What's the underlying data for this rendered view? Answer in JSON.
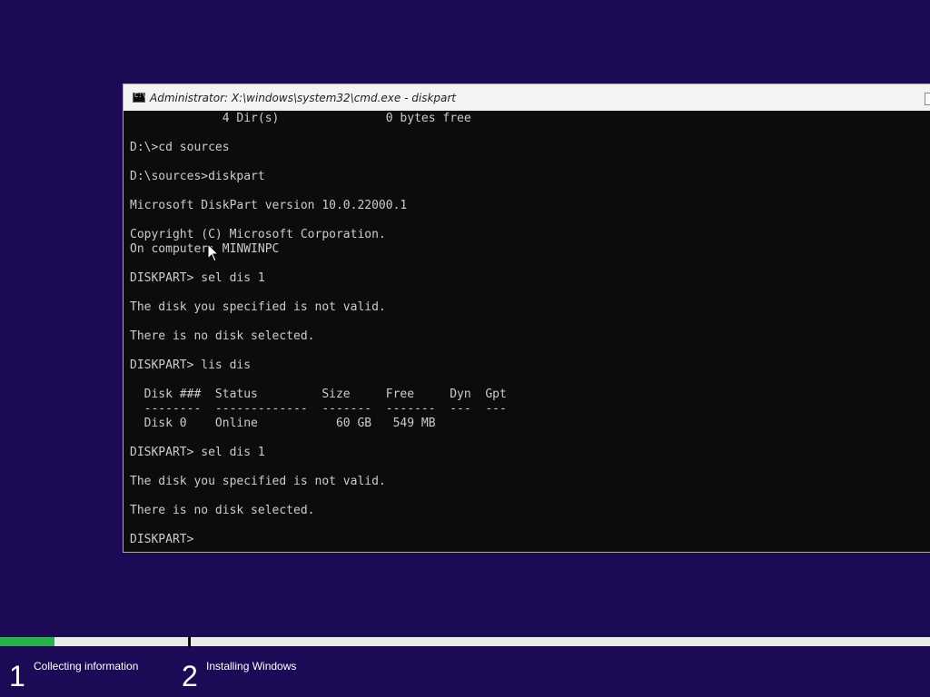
{
  "window": {
    "title": "Administrator: X:\\windows\\system32\\cmd.exe - diskpart",
    "icon": "cmd-icon",
    "icon_text": "C:\\"
  },
  "console": {
    "lines": [
      "             4 Dir(s)               0 bytes free",
      "",
      "D:\\>cd sources",
      "",
      "D:\\sources>diskpart",
      "",
      "Microsoft DiskPart version 10.0.22000.1",
      "",
      "Copyright (C) Microsoft Corporation.",
      "On computer: MINWINPC",
      "",
      "DISKPART> sel dis 1",
      "",
      "The disk you specified is not valid.",
      "",
      "There is no disk selected.",
      "",
      "DISKPART> lis dis",
      "",
      "  Disk ###  Status         Size     Free     Dyn  Gpt",
      "  --------  -------------  -------  -------  ---  ---",
      "  Disk 0    Online           60 GB   549 MB",
      "",
      "DISKPART> sel dis 1",
      "",
      "The disk you specified is not valid.",
      "",
      "There is no disk selected.",
      "",
      "DISKPART> "
    ],
    "text_color": "#cccccc",
    "background": "#0c0c0c"
  },
  "setup": {
    "background": "#1c0a57",
    "progress_color": "#28b34a",
    "step1_progress": 0.29,
    "steps": [
      {
        "number": "1",
        "label": "Collecting information"
      },
      {
        "number": "2",
        "label": "Installing Windows"
      }
    ]
  }
}
